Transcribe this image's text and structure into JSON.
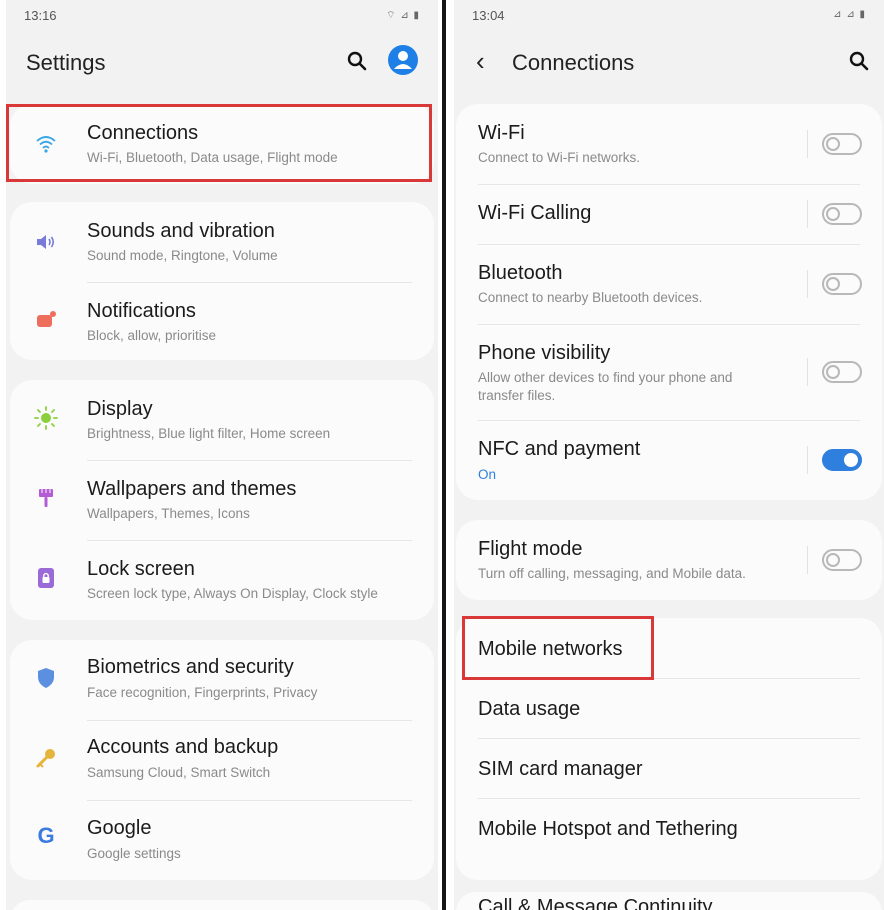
{
  "left": {
    "status": {
      "time": "13:16",
      "icons": "⌔ ⊿ ▮"
    },
    "title": "Settings",
    "colors": {
      "accent": "#1e7fe6",
      "highlight": "#d93838"
    },
    "connections": {
      "label": "Connections",
      "sub": "Wi-Fi, Bluetooth, Data usage, Flight mode"
    },
    "sounds": {
      "label": "Sounds and vibration",
      "sub": "Sound mode, Ringtone, Volume"
    },
    "notifications": {
      "label": "Notifications",
      "sub": "Block, allow, prioritise"
    },
    "display": {
      "label": "Display",
      "sub": "Brightness, Blue light filter, Home screen"
    },
    "wallpapers": {
      "label": "Wallpapers and themes",
      "sub": "Wallpapers, Themes, Icons"
    },
    "lockscreen": {
      "label": "Lock screen",
      "sub": "Screen lock type, Always On Display, Clock style"
    },
    "biometrics": {
      "label": "Biometrics and security",
      "sub": "Face recognition, Fingerprints, Privacy"
    },
    "accounts": {
      "label": "Accounts and backup",
      "sub": "Samsung Cloud, Smart Switch"
    },
    "google": {
      "label": "Google",
      "sub": "Google settings",
      "icon_letter": "G"
    }
  },
  "right": {
    "status": {
      "time": "13:04",
      "icons": "⊿ ⊿ ▮"
    },
    "back_glyph": "‹",
    "title": "Connections",
    "wifi": {
      "label": "Wi-Fi",
      "sub": "Connect to Wi-Fi networks.",
      "on": false
    },
    "wificalling": {
      "label": "Wi-Fi Calling",
      "on": false
    },
    "bluetooth": {
      "label": "Bluetooth",
      "sub": "Connect to nearby Bluetooth devices.",
      "on": false
    },
    "visibility": {
      "label": "Phone visibility",
      "sub1": "Allow other devices to find your phone and",
      "sub2": "transfer files.",
      "on": false
    },
    "nfc": {
      "label": "NFC and payment",
      "sub": "On",
      "on": true
    },
    "flight": {
      "label": "Flight mode",
      "sub": "Turn off calling, messaging, and Mobile data.",
      "on": false
    },
    "mobilenetworks": {
      "label": "Mobile networks"
    },
    "datausage": {
      "label": "Data usage"
    },
    "simmanager": {
      "label": "SIM card manager"
    },
    "hotspot": {
      "label": "Mobile Hotspot and Tethering"
    },
    "cutoff": {
      "label": "Call & Message Continuity"
    }
  }
}
